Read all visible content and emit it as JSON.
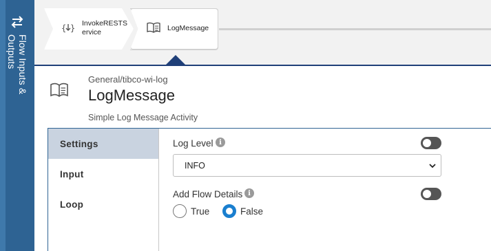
{
  "rail": {
    "label": "Flow Inputs & Outputs",
    "icon": "swap-arrows-icon"
  },
  "flow": {
    "tiles": [
      {
        "label": "InvokeRESTService",
        "icon": "rest-service-icon"
      },
      {
        "label": "LogMessage",
        "icon": "book-icon"
      }
    ]
  },
  "activity": {
    "ref": "General/tibco-wi-log",
    "title": "LogMessage",
    "description": "Simple Log Message Activity",
    "icon": "book-icon"
  },
  "tabs": [
    {
      "label": "Settings",
      "active": true
    },
    {
      "label": "Input",
      "active": false
    },
    {
      "label": "Loop",
      "active": false
    }
  ],
  "settings": {
    "log_level": {
      "label": "Log Level",
      "value": "INFO",
      "toggle_on": false
    },
    "add_flow_details": {
      "label": "Add Flow Details",
      "toggle_on": false,
      "options": [
        "True",
        "False"
      ],
      "selected": "False"
    }
  },
  "colors": {
    "rail": "#2e6393",
    "accent": "#1a7fcf",
    "active_tab": "#c9d3e0",
    "pointer": "#1f3f78"
  }
}
